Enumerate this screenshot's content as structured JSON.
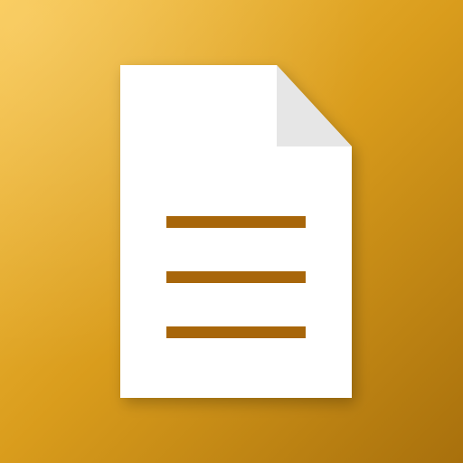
{
  "icon": {
    "name": "document-icon",
    "line_count": 3
  },
  "colors": {
    "background_light": "#F9C444",
    "background_mid": "#D99C1C",
    "background_dark": "#A8700C",
    "sheet": "#FFFFFF",
    "fold": "#E6E6E6",
    "lines": "#A8660A"
  }
}
